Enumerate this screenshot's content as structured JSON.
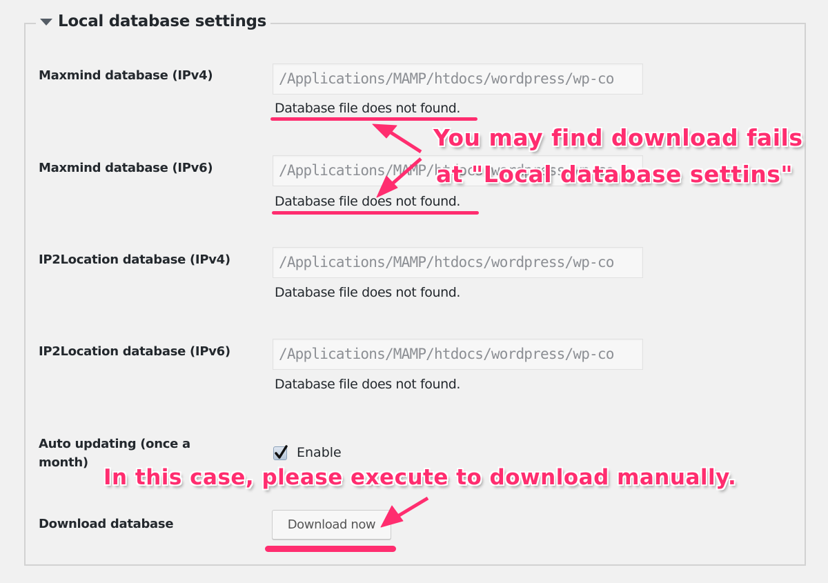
{
  "section": {
    "title": "Local database settings",
    "collapse_icon": "triangle-down-icon"
  },
  "fields": [
    {
      "label": "Maxmind database (IPv4)",
      "value": "/Applications/MAMP/htdocs/wordpress/wp-co",
      "status": "Database file does not found."
    },
    {
      "label": "Maxmind database (IPv6)",
      "value": "/Applications/MAMP/htdocs/wordpress/wp-co",
      "status": "Database file does not found."
    },
    {
      "label": "IP2Location database (IPv4)",
      "value": "/Applications/MAMP/htdocs/wordpress/wp-co",
      "status": "Database file does not found."
    },
    {
      "label": "IP2Location database (IPv6)",
      "value": "/Applications/MAMP/htdocs/wordpress/wp-co",
      "status": "Database file does not found."
    }
  ],
  "auto_update": {
    "label_line1": "Auto updating (once a",
    "label_line2": "month)",
    "checkbox_label": "Enable",
    "checked": true
  },
  "download": {
    "label": "Download database",
    "button_label": "Download now"
  },
  "annotations": {
    "line1": "You may find download fails",
    "line2": "at \"Local database settins\"",
    "line3": "In this case, please execute to download manually.",
    "color": "#ff2d6f"
  }
}
